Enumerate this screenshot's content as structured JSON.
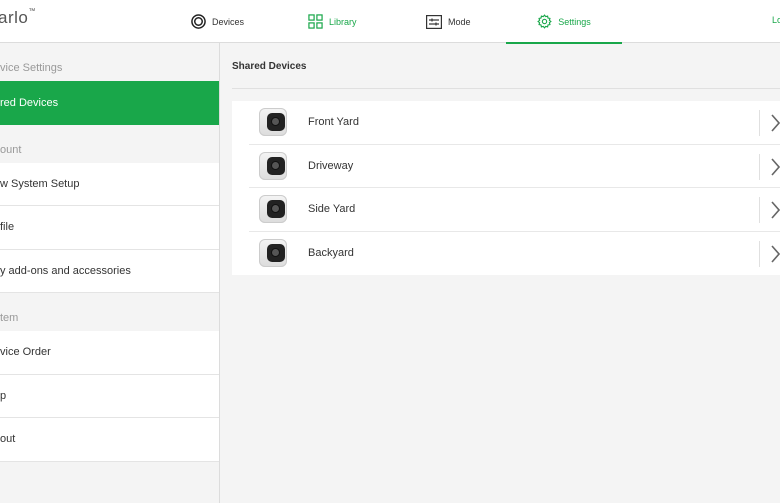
{
  "header": {
    "logo": "arlo",
    "tabs": [
      {
        "label": "Devices",
        "icon": "devices-circle-icon"
      },
      {
        "label": "Library",
        "icon": "grid-icon"
      },
      {
        "label": "Mode",
        "icon": "sliders-icon"
      },
      {
        "label": "Settings",
        "icon": "gear-icon",
        "active": true
      }
    ],
    "logout_label": "Lo"
  },
  "sidebar": {
    "sections": [
      {
        "header": "vice Settings",
        "items": [
          {
            "label": "red Devices",
            "active": true
          }
        ]
      },
      {
        "header": "ount",
        "items": [
          {
            "label": "w System Setup"
          },
          {
            "label": "file"
          },
          {
            "label": "y add-ons and accessories"
          }
        ]
      },
      {
        "header": "tem",
        "items": [
          {
            "label": "vice Order"
          },
          {
            "label": "p"
          },
          {
            "label": "out"
          }
        ]
      }
    ]
  },
  "main": {
    "title": "Shared Devices",
    "devices": [
      {
        "name": "Front Yard"
      },
      {
        "name": "Driveway"
      },
      {
        "name": "Side Yard"
      },
      {
        "name": "Backyard"
      }
    ]
  },
  "colors": {
    "accent": "#19a74a"
  }
}
